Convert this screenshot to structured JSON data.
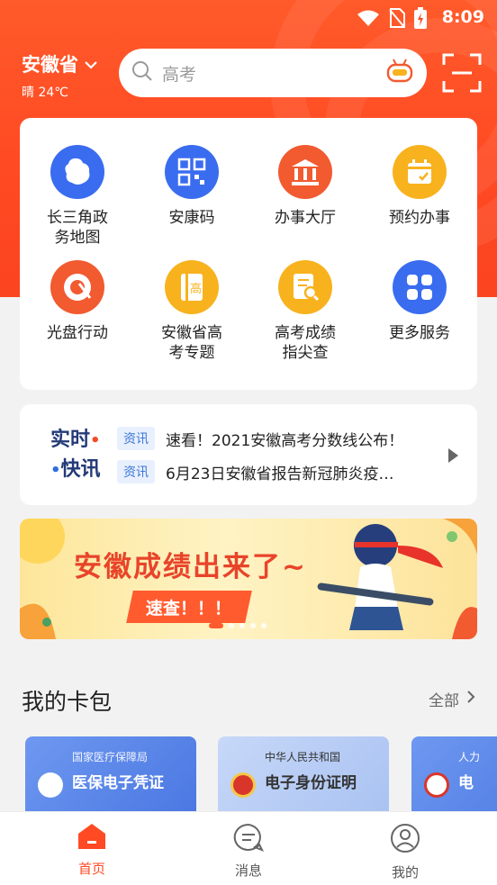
{
  "status_bar": {
    "time": "8:09"
  },
  "header": {
    "province": "安徽省",
    "weather": "晴 24℃",
    "search_placeholder": "高考"
  },
  "services": [
    {
      "label": "长三角政务地图",
      "icon": "map-icon",
      "color": "#3a6cf0"
    },
    {
      "label": "安康码",
      "icon": "qr-code-icon",
      "color": "#3a6cf0"
    },
    {
      "label": "办事大厅",
      "icon": "hall-icon",
      "color": "#f25a30"
    },
    {
      "label": "预约办事",
      "icon": "calendar-icon",
      "color": "#f8b21e"
    },
    {
      "label": "光盘行动",
      "icon": "plate-icon",
      "color": "#f25a30"
    },
    {
      "label": "安徽省高考专题",
      "icon": "book-icon",
      "color": "#f8b21e"
    },
    {
      "label": "高考成绩指尖查",
      "icon": "document-search-icon",
      "color": "#f8b21e"
    },
    {
      "label": "更多服务",
      "icon": "grid-icon",
      "color": "#3a6cf0"
    }
  ],
  "news": {
    "brand_line1": "实时",
    "brand_line2": "快讯",
    "items": [
      {
        "tag": "资讯",
        "text": "速看！2021安徽高考分数线公布！"
      },
      {
        "tag": "资讯",
        "text": "6月23日安徽省报告新冠肺炎疫…"
      }
    ]
  },
  "banner": {
    "headline": "安徽成绩出来了~",
    "cta": "速查！！！",
    "slide_count": 5,
    "active_slide": 1
  },
  "wallet": {
    "title": "我的卡包",
    "all_label": "全部",
    "cards": [
      {
        "org": "国家医疗保障局",
        "name": "医保电子凭证",
        "theme": "#4d7ee8"
      },
      {
        "org": "中华人民共和国",
        "name": "电子身份证明",
        "theme": "#a9c2f2"
      },
      {
        "org": "人力",
        "name": "电",
        "theme": "#4d7ee8"
      }
    ]
  },
  "tabs": [
    {
      "label": "首页",
      "active": true
    },
    {
      "label": "消息",
      "active": false
    },
    {
      "label": "我的",
      "active": false
    }
  ],
  "colors": {
    "brand": "#ff4a23",
    "active_tab": "#ff4a23",
    "inactive_tab": "#555555"
  }
}
